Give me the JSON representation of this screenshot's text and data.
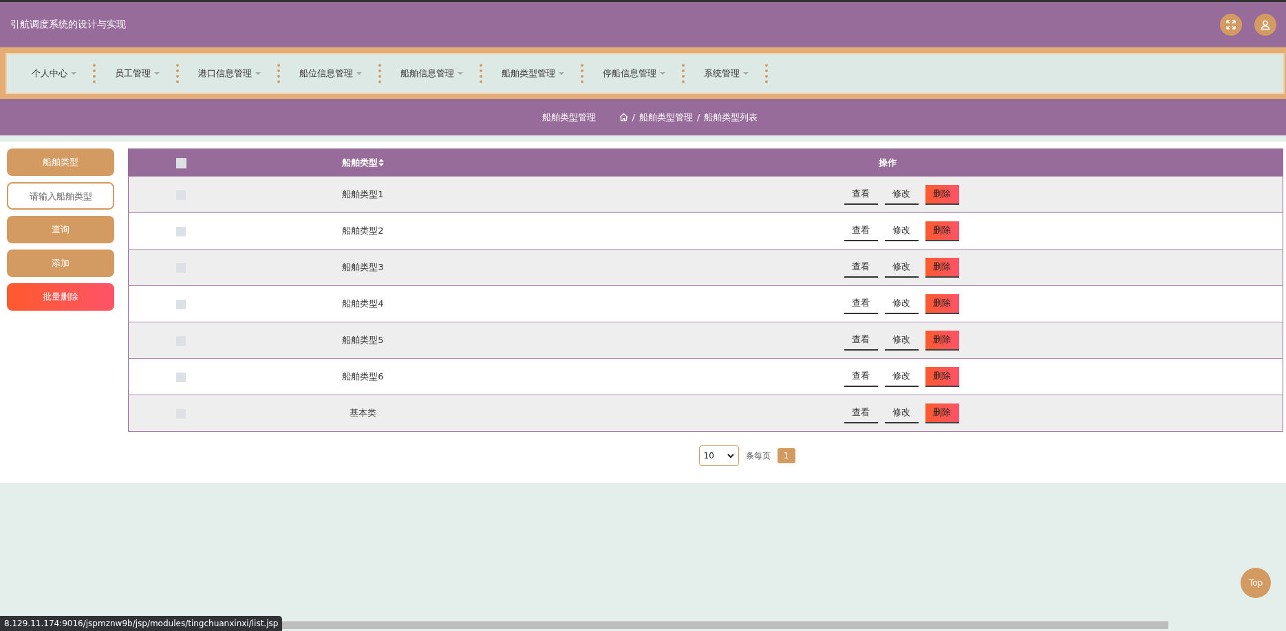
{
  "header": {
    "title": "引航调度系统的设计与实现"
  },
  "nav": {
    "items": [
      {
        "label": "个人中心"
      },
      {
        "label": "员工管理"
      },
      {
        "label": "港口信息管理"
      },
      {
        "label": "船位信息管理"
      },
      {
        "label": "船舶信息管理"
      },
      {
        "label": "船舶类型管理"
      },
      {
        "label": "停船信息管理"
      },
      {
        "label": "系统管理"
      }
    ]
  },
  "breadcrumb": {
    "title": "船舶类型管理",
    "separator": "/",
    "path": [
      "船舶类型管理",
      "船舶类型列表"
    ]
  },
  "sidebar": {
    "field_label": "船舶类型",
    "search": {
      "placeholder": "请输入船舶类型"
    },
    "buttons": [
      {
        "label": "查询",
        "kind": "normal"
      },
      {
        "label": "添加",
        "kind": "normal"
      },
      {
        "label": "批量删除",
        "kind": "danger"
      }
    ]
  },
  "table": {
    "select_all": {
      "checked": false
    },
    "columns": [
      "船舶类型",
      "操作"
    ],
    "rows": [
      {
        "checked": false,
        "type": "船舶类型1",
        "actions": [
          "查看",
          "修改",
          "删除"
        ]
      },
      {
        "checked": false,
        "type": "船舶类型2",
        "actions": [
          "查看",
          "修改",
          "删除"
        ]
      },
      {
        "checked": false,
        "type": "船舶类型3",
        "actions": [
          "查看",
          "修改",
          "删除"
        ]
      },
      {
        "checked": false,
        "type": "船舶类型4",
        "actions": [
          "查看",
          "修改",
          "删除"
        ]
      },
      {
        "checked": false,
        "type": "船舶类型5",
        "actions": [
          "查看",
          "修改",
          "删除"
        ]
      },
      {
        "checked": false,
        "type": "船舶类型6",
        "actions": [
          "查看",
          "修改",
          "删除"
        ]
      },
      {
        "checked": false,
        "type": "基本类",
        "actions": [
          "查看",
          "修改",
          "删除"
        ]
      }
    ]
  },
  "pagination": {
    "page_size": "10",
    "per_page_label": "条每页",
    "pages": [
      {
        "label": "1",
        "selected": true
      }
    ]
  },
  "top_button": "Top",
  "status_url": "8.129.11.174:9016/jspmznw9b/jsp/modules/tingchuanxinxi/list.jsp"
}
